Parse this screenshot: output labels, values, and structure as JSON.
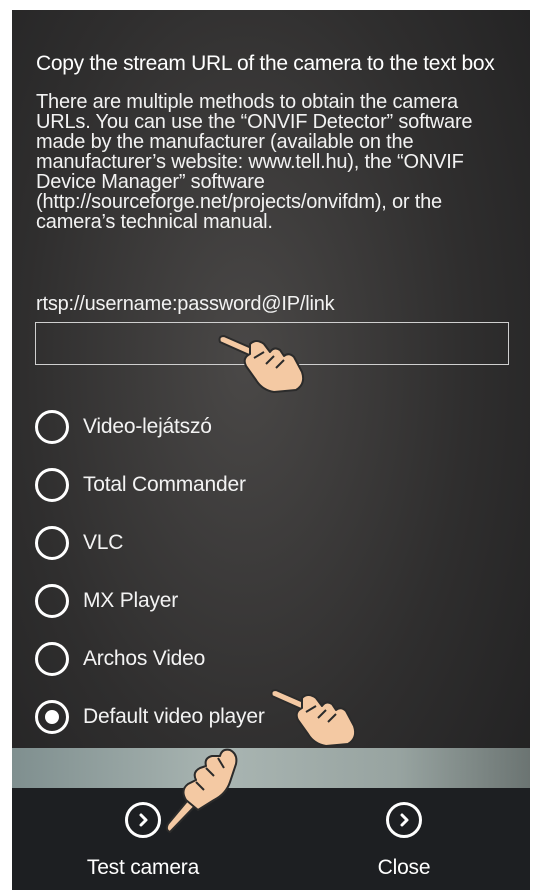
{
  "instruction": {
    "title": "Copy the stream URL of the camera to the text box",
    "description": "There are multiple methods to obtain the camera URLs. You can use the “ONVIF Detector” software made by the manufacturer (available on the manufacturer’s website: www.tell.hu), the “ONVIF Device Manager” software (http://sourceforge.net/projects/onvifdm), or the camera’s technical manual."
  },
  "url_field": {
    "hint": "rtsp://username:password@IP/link",
    "value": ""
  },
  "players": [
    {
      "label": "Video-lejátszó",
      "selected": false
    },
    {
      "label": "Total Commander",
      "selected": false
    },
    {
      "label": "VLC",
      "selected": false
    },
    {
      "label": "MX Player",
      "selected": false
    },
    {
      "label": "Archos Video",
      "selected": false
    },
    {
      "label": "Default video player",
      "selected": true
    }
  ],
  "bottom_bar": {
    "test_label": "Test camera",
    "close_label": "Close"
  },
  "icons": {
    "radio": "radio-icon",
    "action": "chevron-right-circle-icon",
    "pointer": "pointing-hand-icon"
  }
}
